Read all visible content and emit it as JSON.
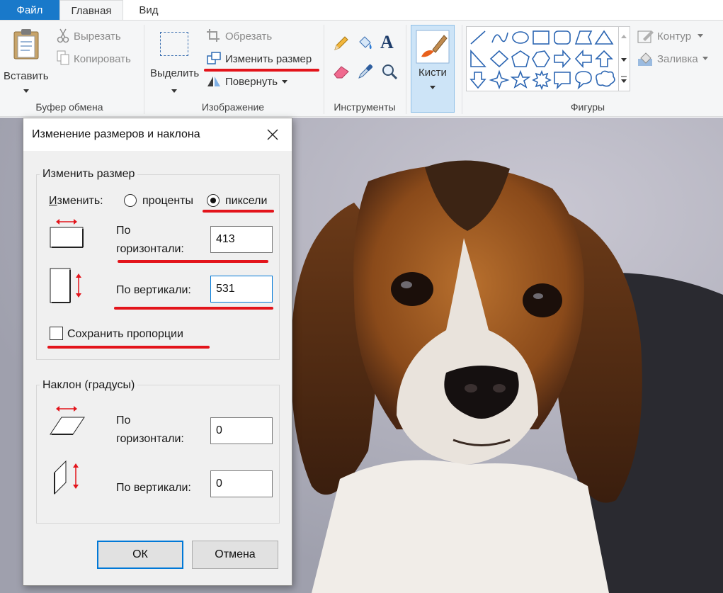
{
  "menu": {
    "file": "Файл",
    "home": "Главная",
    "view": "Вид"
  },
  "ribbon": {
    "clipboard": {
      "paste": "Вставить",
      "cut": "Вырезать",
      "copy": "Копировать",
      "group": "Буфер обмена"
    },
    "image": {
      "select": "Выделить",
      "crop": "Обрезать",
      "resize": "Изменить размер",
      "rotate": "Повернуть",
      "group": "Изображение"
    },
    "tools": {
      "group": "Инструменты"
    },
    "brushes": {
      "label": "Кисти"
    },
    "shapes": {
      "group": "Фигуры",
      "outline": "Контур",
      "fill": "Заливка"
    }
  },
  "dialog": {
    "title": "Изменение размеров и наклона",
    "resize_group": "Изменить размер",
    "by_label": "Изменить:",
    "percent": "проценты",
    "pixels": "пиксели",
    "selected_unit": "пиксели",
    "horizontal_label_1": "По",
    "horizontal_label_2": "горизонтали:",
    "horizontal_value": "413",
    "vertical_label": "По вертикали:",
    "vertical_value": "531",
    "keep_ratio": "Сохранить пропорции",
    "keep_ratio_checked": false,
    "skew_group": "Наклон (градусы)",
    "skew_h_label_1": "По",
    "skew_h_label_2": "горизонтали:",
    "skew_h_value": "0",
    "skew_v_label": "По вертикали:",
    "skew_v_value": "0",
    "ok": "ОК",
    "cancel": "Отмена"
  },
  "colors": {
    "accent": "#1979ca",
    "highlight": "#e3141b",
    "focus": "#0078d7"
  }
}
